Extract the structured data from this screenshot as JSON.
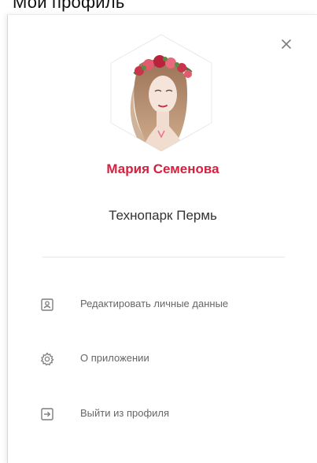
{
  "page": {
    "title": "Мой профиль"
  },
  "profile": {
    "name": "Мария Семенова",
    "organization": "Технопарк Пермь"
  },
  "menu": [
    {
      "label": "Редактировать личные данные",
      "icon": "profile-card-icon"
    },
    {
      "label": "О приложении",
      "icon": "gear-icon"
    },
    {
      "label": "Выйти из профиля",
      "icon": "logout-icon"
    }
  ],
  "colors": {
    "accent": "#d81f3f",
    "text_primary": "#333333",
    "text_secondary": "#666666",
    "icon": "#7d7d7d"
  },
  "icons": {
    "close": "close-icon",
    "avatar": "avatar"
  }
}
